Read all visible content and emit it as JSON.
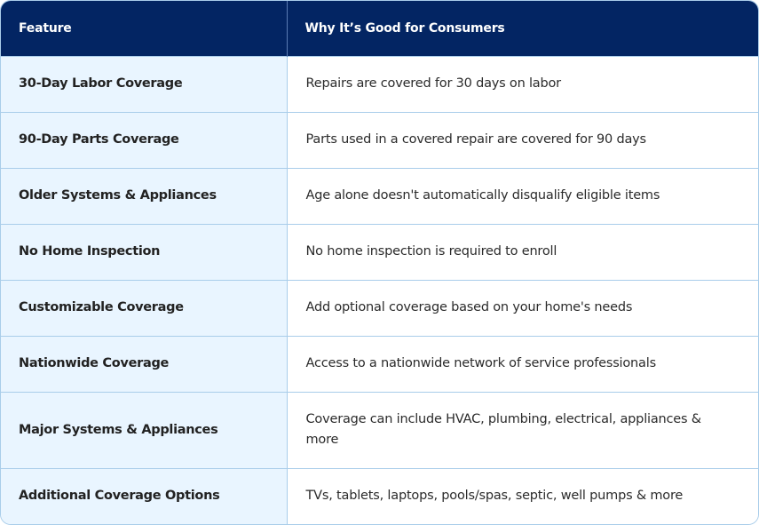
{
  "table": {
    "headers": [
      "Feature",
      "Why It’s Good for Consumers"
    ],
    "rows": [
      {
        "feature": "30-Day Labor Coverage",
        "why": "Repairs are covered for 30 days on labor"
      },
      {
        "feature": "90-Day Parts Coverage",
        "why": "Parts used in a covered repair are covered for 90 days"
      },
      {
        "feature": "Older Systems & Appliances",
        "why": "Age alone doesn't automatically disqualify eligible items"
      },
      {
        "feature": "No Home Inspection",
        "why": "No home inspection is required to enroll"
      },
      {
        "feature": "Customizable Coverage",
        "why": "Add optional coverage based on your home's needs"
      },
      {
        "feature": "Nationwide Coverage",
        "why": "Access to a nationwide network of service professionals"
      },
      {
        "feature": "Major Systems & Appliances",
        "why": "Coverage can include HVAC, plumbing, electrical, appliances & more"
      },
      {
        "feature": "Additional Coverage Options",
        "why": " TVs, tablets, laptops, pools/spas, septic, well pumps & more"
      }
    ]
  },
  "colors": {
    "header_bg": "#032563",
    "feature_bg": "#e9f5ff",
    "border": "#a9cdea"
  }
}
